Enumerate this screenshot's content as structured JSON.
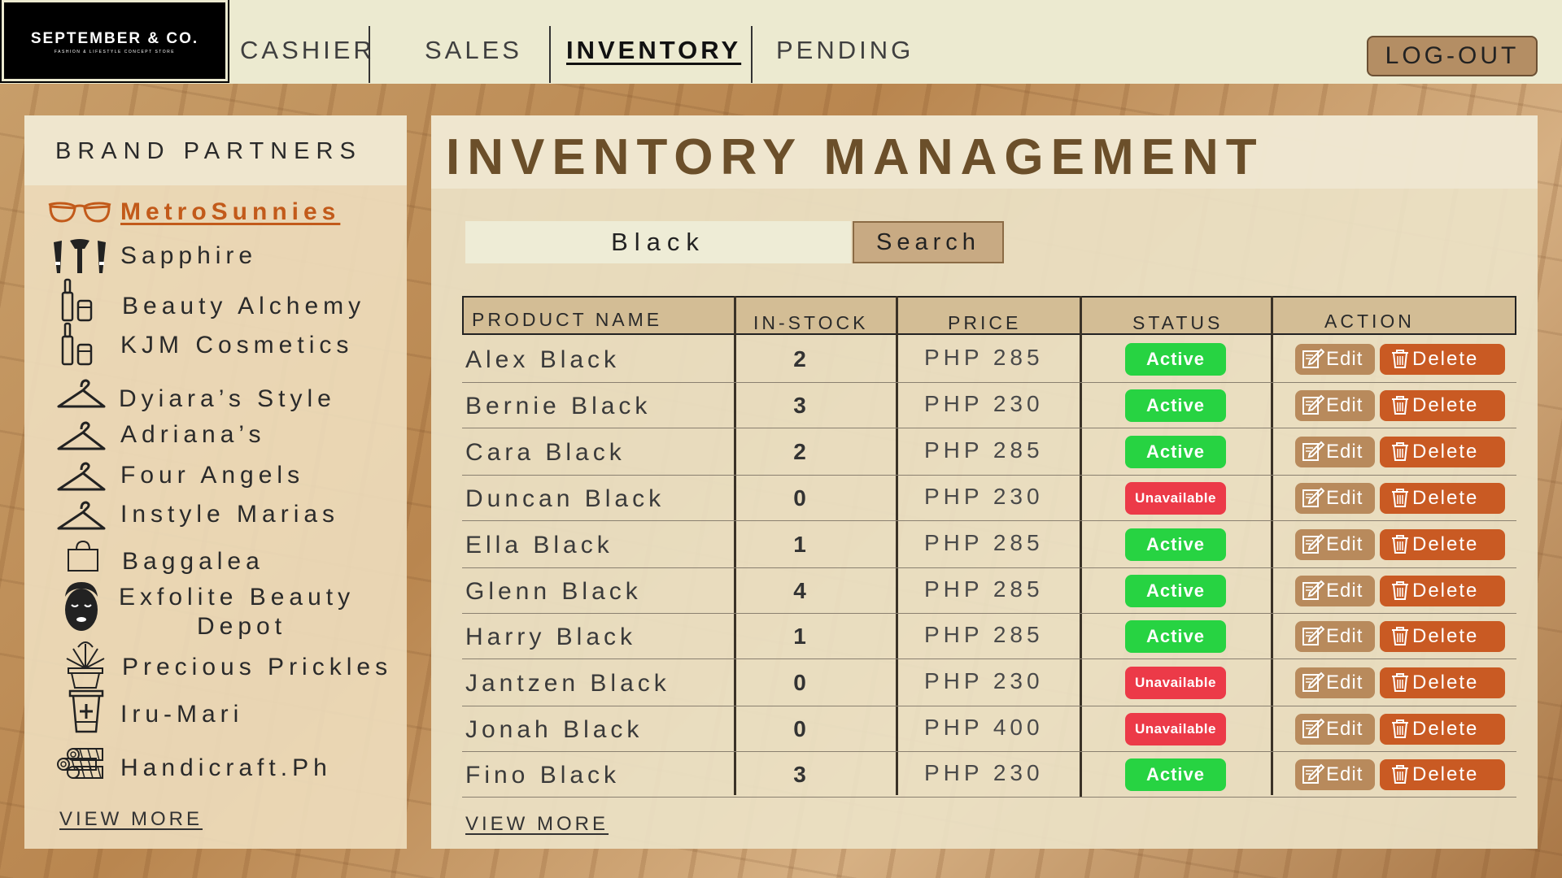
{
  "brand": {
    "name": "SEPTEMBER & CO.",
    "tagline": "FASHION & LIFESTYLE CONCEPT STORE"
  },
  "nav": {
    "items": [
      {
        "label": "CASHIER"
      },
      {
        "label": "SALES"
      },
      {
        "label": "INVENTORY"
      },
      {
        "label": "PENDING"
      }
    ],
    "active": "INVENTORY",
    "logout_label": "LOG-OUT"
  },
  "sidebar": {
    "title": "BRAND PARTNERS",
    "items": [
      {
        "label": "MetroSunnies",
        "icon": "sunglasses-icon",
        "active": true
      },
      {
        "label": "Sapphire",
        "icon": "makeup-brushes-icon"
      },
      {
        "label": "Beauty Alchemy",
        "icon": "cosmetics-bottle-icon"
      },
      {
        "label": "KJM Cosmetics",
        "icon": "cosmetics-bottle-icon"
      },
      {
        "label": "Dyiara’s Style",
        "icon": "hanger-icon"
      },
      {
        "label": "Adriana’s",
        "icon": "hanger-icon"
      },
      {
        "label": "Four Angels",
        "icon": "hanger-icon"
      },
      {
        "label": "Instyle Marias",
        "icon": "hanger-icon"
      },
      {
        "label": "Baggalea",
        "icon": "bag-icon"
      },
      {
        "label": "Exfolite Beauty",
        "label2": "Depot",
        "icon": "face-mask-icon"
      },
      {
        "label": "Precious Prickles",
        "icon": "potted-plant-icon"
      },
      {
        "label": "Iru-Mari",
        "icon": "cup-icon"
      },
      {
        "label": "Handicraft.Ph",
        "icon": "woven-rolls-icon"
      }
    ],
    "view_more": "VIEW MORE"
  },
  "main": {
    "title": "INVENTORY MANAGEMENT",
    "search": {
      "value": "Black",
      "button_label": "Search"
    },
    "table": {
      "columns": [
        "PRODUCT NAME",
        "IN-STOCK",
        "PRICE",
        "STATUS",
        "ACTION"
      ],
      "rows": [
        {
          "name": "Alex Black",
          "stock": "2",
          "price": "PHP 285",
          "status": "Active"
        },
        {
          "name": "Bernie Black",
          "stock": "3",
          "price": "PHP 230",
          "status": "Active"
        },
        {
          "name": "Cara Black",
          "stock": "2",
          "price": "PHP 285",
          "status": "Active"
        },
        {
          "name": "Duncan Black",
          "stock": "0",
          "price": "PHP 230",
          "status": "Unavailable"
        },
        {
          "name": "Ella Black",
          "stock": "1",
          "price": "PHP 285",
          "status": "Active"
        },
        {
          "name": "Glenn Black",
          "stock": "4",
          "price": "PHP 285",
          "status": "Active"
        },
        {
          "name": "Harry Black",
          "stock": "1",
          "price": "PHP 285",
          "status": "Active"
        },
        {
          "name": "Jantzen Black",
          "stock": "0",
          "price": "PHP 230",
          "status": "Unavailable"
        },
        {
          "name": "Jonah Black",
          "stock": "0",
          "price": "PHP 400",
          "status": "Unavailable"
        },
        {
          "name": "Fino Black",
          "stock": "3",
          "price": "PHP 230",
          "status": "Active"
        }
      ],
      "edit_label": "Edit",
      "delete_label": "Delete"
    },
    "view_more": "VIEW MORE"
  },
  "colors": {
    "accent": "#6b4f2a",
    "active_status": "#27d342",
    "unavailable_status": "#ec3a48",
    "delete_button": "#c95a23",
    "edit_button": "#b88a5c",
    "active_brand": "#c25a1a"
  }
}
